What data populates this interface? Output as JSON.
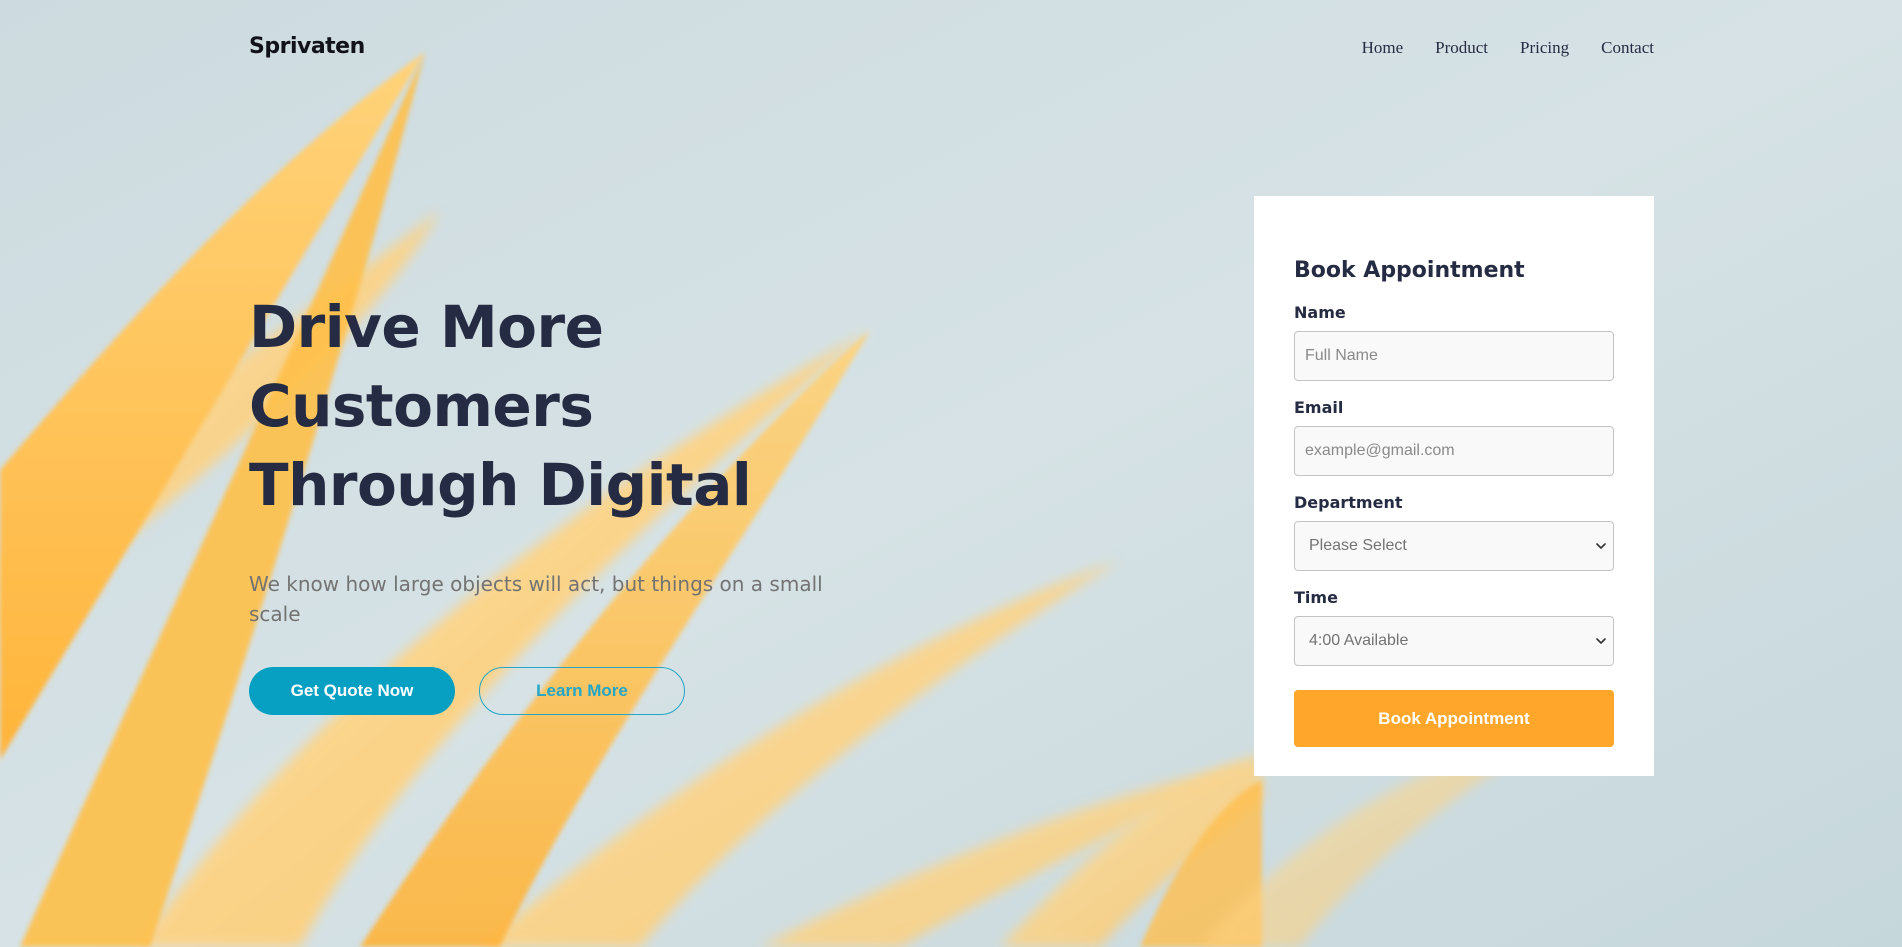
{
  "brand": {
    "name": "Sprivaten"
  },
  "nav": {
    "items": [
      "Home",
      "Product",
      "Pricing",
      "Contact"
    ]
  },
  "hero": {
    "title_lines": [
      "Drive More",
      "Customers",
      "Through Digital"
    ],
    "subtitle": "We know how large objects will act, but things on a small scale",
    "primary_cta": "Get Quote Now",
    "secondary_cta": "Learn More"
  },
  "form": {
    "title": "Book Appointment",
    "name": {
      "label": "Name",
      "placeholder": "Full Name"
    },
    "email": {
      "label": "Email",
      "placeholder": "example@gmail.com"
    },
    "department": {
      "label": "Department",
      "selected": "Please Select"
    },
    "time": {
      "label": "Time",
      "selected": "4:00 Available"
    },
    "submit_label": "Book Appointment"
  },
  "colors": {
    "background": "#d3e0e4",
    "leaf": "#ffb93c",
    "primary": "#08a0c2",
    "accent": "#ffa62b",
    "heading": "#252b42",
    "muted": "#737373"
  },
  "icons": {
    "select_arrow": "chevron-down-icon"
  }
}
